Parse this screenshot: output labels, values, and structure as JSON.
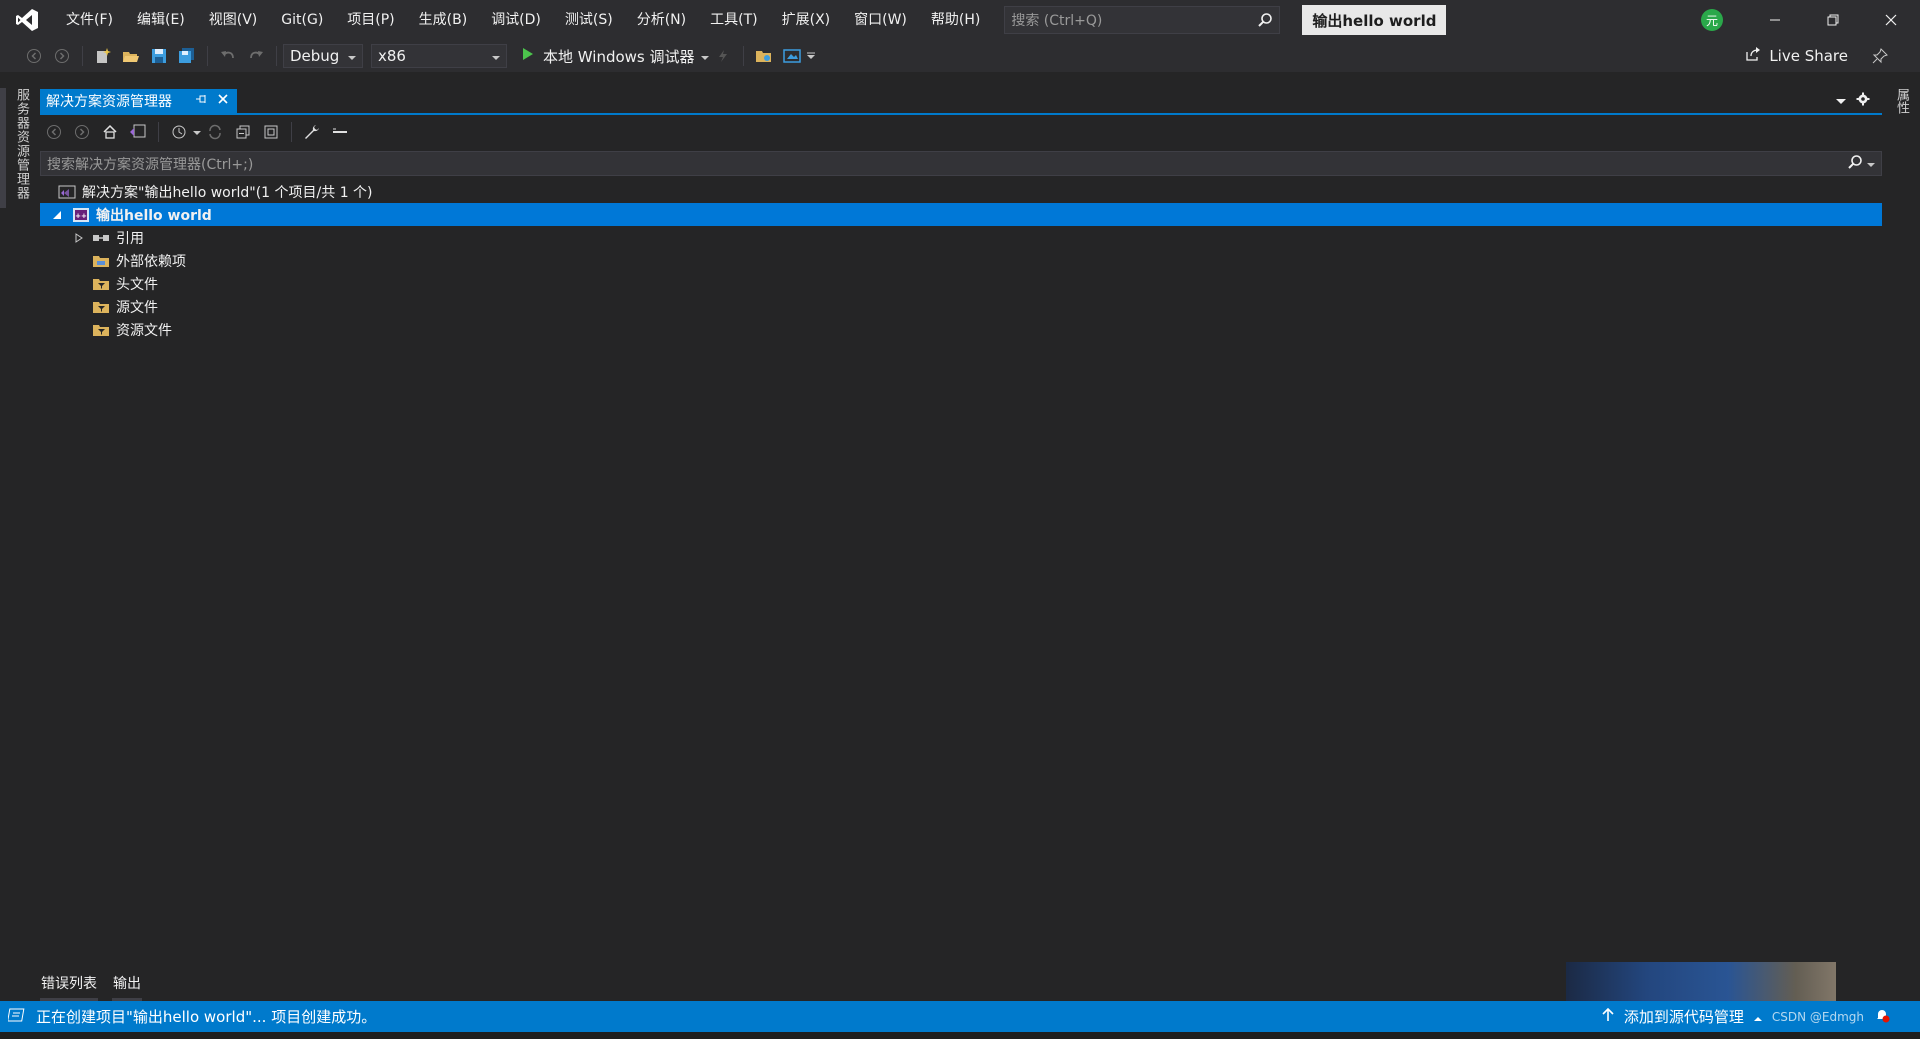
{
  "titlebar": {
    "menus": [
      "文件(F)",
      "编辑(E)",
      "视图(V)",
      "Git(G)",
      "项目(P)",
      "生成(B)",
      "调试(D)",
      "测试(S)",
      "分析(N)",
      "工具(T)",
      "扩展(X)",
      "窗口(W)",
      "帮助(H)"
    ],
    "search_placeholder": "搜索 (Ctrl+Q)",
    "solution_name": "输出hello world",
    "account_initial": "元"
  },
  "toolbar": {
    "configuration": "Debug",
    "platform": "x86",
    "run_label": "本地 Windows 调试器",
    "live_share": "Live Share"
  },
  "side_rails": {
    "left": "服务器资源管理器",
    "right": "属性"
  },
  "solution_explorer": {
    "tab_title": "解决方案资源管理器",
    "search_placeholder": "搜索解决方案资源管理器(Ctrl+;)",
    "tree": {
      "solution": "解决方案\"输出hello world\"(1 个项目/共 1 个)",
      "project": "输出hello world",
      "children": [
        "引用",
        "外部依赖项",
        "头文件",
        "源文件",
        "资源文件"
      ]
    }
  },
  "bottom_tabs": [
    "错误列表",
    "输出"
  ],
  "statusbar": {
    "message": "正在创建项目\"输出hello world\"... 项目创建成功。",
    "source_control": "添加到源代码管理",
    "watermark": "CSDN @Edmgh"
  },
  "colors": {
    "accent": "#007acc",
    "selection": "#0078d7",
    "background": "#252526",
    "chrome": "#2d2d30"
  }
}
